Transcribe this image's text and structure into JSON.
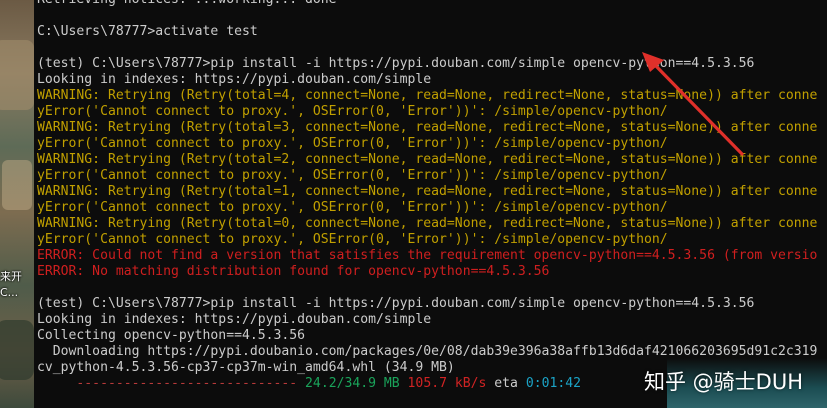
{
  "desktop": {
    "icon_labels": [
      "来开",
      "C..."
    ]
  },
  "terminal": {
    "lines": [
      {
        "text": "Retrieving notices: ...working... done",
        "kind": "normal"
      },
      {
        "text": "",
        "kind": "normal"
      },
      {
        "text": "C:\\Users\\78777>activate test",
        "kind": "normal"
      },
      {
        "text": "",
        "kind": "normal"
      },
      {
        "text": "(test) C:\\Users\\78777>pip install -i https://pypi.douban.com/simple opencv-python==4.5.3.56",
        "kind": "normal"
      },
      {
        "text": "Looking in indexes: https://pypi.douban.com/simple",
        "kind": "normal"
      },
      {
        "text": "WARNING: Retrying (Retry(total=4, connect=None, read=None, redirect=None, status=None)) after conne",
        "kind": "warn"
      },
      {
        "text": "yError('Cannot connect to proxy.', OSError(0, 'Error'))': /simple/opencv-python/",
        "kind": "warn"
      },
      {
        "text": "WARNING: Retrying (Retry(total=3, connect=None, read=None, redirect=None, status=None)) after conne",
        "kind": "warn"
      },
      {
        "text": "yError('Cannot connect to proxy.', OSError(0, 'Error'))': /simple/opencv-python/",
        "kind": "warn"
      },
      {
        "text": "WARNING: Retrying (Retry(total=2, connect=None, read=None, redirect=None, status=None)) after conne",
        "kind": "warn"
      },
      {
        "text": "yError('Cannot connect to proxy.', OSError(0, 'Error'))': /simple/opencv-python/",
        "kind": "warn"
      },
      {
        "text": "WARNING: Retrying (Retry(total=1, connect=None, read=None, redirect=None, status=None)) after conne",
        "kind": "warn"
      },
      {
        "text": "yError('Cannot connect to proxy.', OSError(0, 'Error'))': /simple/opencv-python/",
        "kind": "warn"
      },
      {
        "text": "WARNING: Retrying (Retry(total=0, connect=None, read=None, redirect=None, status=None)) after conne",
        "kind": "warn"
      },
      {
        "text": "yError('Cannot connect to proxy.', OSError(0, 'Error'))': /simple/opencv-python/",
        "kind": "warn"
      },
      {
        "text": "ERROR: Could not find a version that satisfies the requirement opencv-python==4.5.3.56 (from versio",
        "kind": "err"
      },
      {
        "text": "ERROR: No matching distribution found for opencv-python==4.5.3.56",
        "kind": "err"
      },
      {
        "text": "",
        "kind": "normal"
      },
      {
        "text": "(test) C:\\Users\\78777>pip install -i https://pypi.douban.com/simple opencv-python==4.5.3.56",
        "kind": "normal"
      },
      {
        "text": "Looking in indexes: https://pypi.douban.com/simple",
        "kind": "normal"
      },
      {
        "text": "Collecting opencv-python==4.5.3.56",
        "kind": "normal"
      },
      {
        "text": "  Downloading https://pypi.doubanio.com/packages/0e/08/dab39e396a38affb13d6daf421066203695d91c2c319",
        "kind": "normal"
      },
      {
        "text": "cv_python-4.5.3.56-cp37-cp37m-win_amd64.whl (34.9 MB)",
        "kind": "normal"
      }
    ],
    "progress": {
      "bar": "     ----------------------------",
      "size": "24.2/34.9 MB",
      "rate": "105.7 kB/s",
      "eta_label": "eta",
      "eta_time": "0:01:42"
    }
  },
  "watermark": {
    "text": "知乎 @骑士DUH"
  },
  "colors": {
    "terminal_bg": "#0c0c0c",
    "text": "#cccccc",
    "warning": "#c1a000",
    "error": "#d01f1f",
    "arrow": "#e0302a"
  }
}
